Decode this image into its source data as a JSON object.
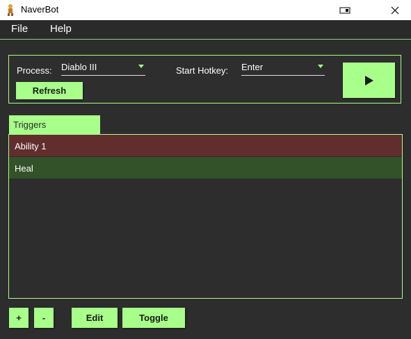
{
  "window": {
    "title": "NaverBot"
  },
  "menu": {
    "items": [
      "File",
      "Help"
    ]
  },
  "controls": {
    "process_label": "Process:",
    "process_value": "Diablo III",
    "hotkey_label": "Start Hotkey:",
    "hotkey_value": "Enter",
    "refresh_label": "Refresh",
    "play_icon": "play-icon"
  },
  "triggers": {
    "tab_label": "Triggers",
    "items": [
      {
        "label": "Ability 1",
        "color": "#612d2d"
      },
      {
        "label": "Heal",
        "color": "#335229"
      }
    ]
  },
  "footer": {
    "add_label": "+",
    "remove_label": "-",
    "edit_label": "Edit",
    "toggle_label": "Toggle"
  },
  "colors": {
    "accent": "#a8ff8a",
    "background": "#2d2d2d"
  }
}
